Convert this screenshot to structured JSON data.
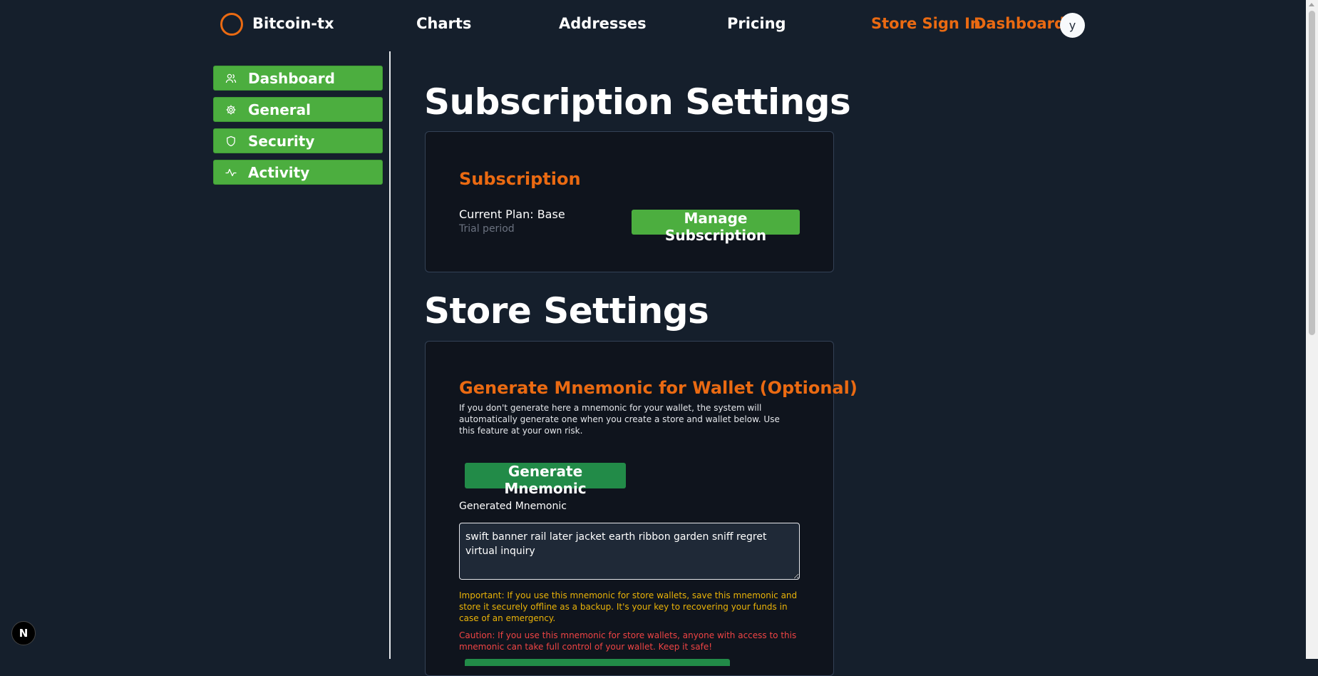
{
  "header": {
    "brand": "Bitcoin-tx",
    "nav": [
      "Charts",
      "Addresses",
      "Pricing"
    ],
    "store_sign_in": "Store Sign In",
    "dashboard": "Dashboard",
    "avatar_initial": "y"
  },
  "sidebar": {
    "items": [
      {
        "label": "Dashboard",
        "icon": "users-icon"
      },
      {
        "label": "General",
        "icon": "gear-icon"
      },
      {
        "label": "Security",
        "icon": "shield-icon"
      },
      {
        "label": "Activity",
        "icon": "activity-icon"
      }
    ]
  },
  "subscription_settings": {
    "heading": "Subscription Settings",
    "card_title": "Subscription",
    "current_plan": "Current Plan: Base",
    "plan_status": "Trial period",
    "manage_button": "Manage Subscription"
  },
  "store_settings": {
    "heading": "Store Settings",
    "card_title": "Generate Mnemonic for Wallet (Optional)",
    "description": "If you don't generate here a mnemonic for your wallet, the system will automatically generate one when you create a store and wallet below. Use this feature at your own risk.",
    "generate_button": "Generate Mnemonic",
    "field_label": "Generated Mnemonic",
    "mnemonic_value": "swift banner rail later jacket earth ribbon garden sniff regret virtual inquiry",
    "important_note": "Important: If you use this mnemonic for store wallets, save this mnemonic and store it securely offline as a backup. It's your key to recovering your funds in case of an emergency.",
    "caution_note": "Caution: If you use this mnemonic for store wallets, anyone with access to this mnemonic can take full control of your wallet. Keep it safe!"
  },
  "dev_badge": "N",
  "colors": {
    "background": "#151f2c",
    "accent_orange": "#ea6a12",
    "sidebar_green": "#4cae3f",
    "generate_green": "#228b48",
    "card_bg": "#0f141d",
    "warning": "#eab308",
    "danger": "#ef4444"
  }
}
